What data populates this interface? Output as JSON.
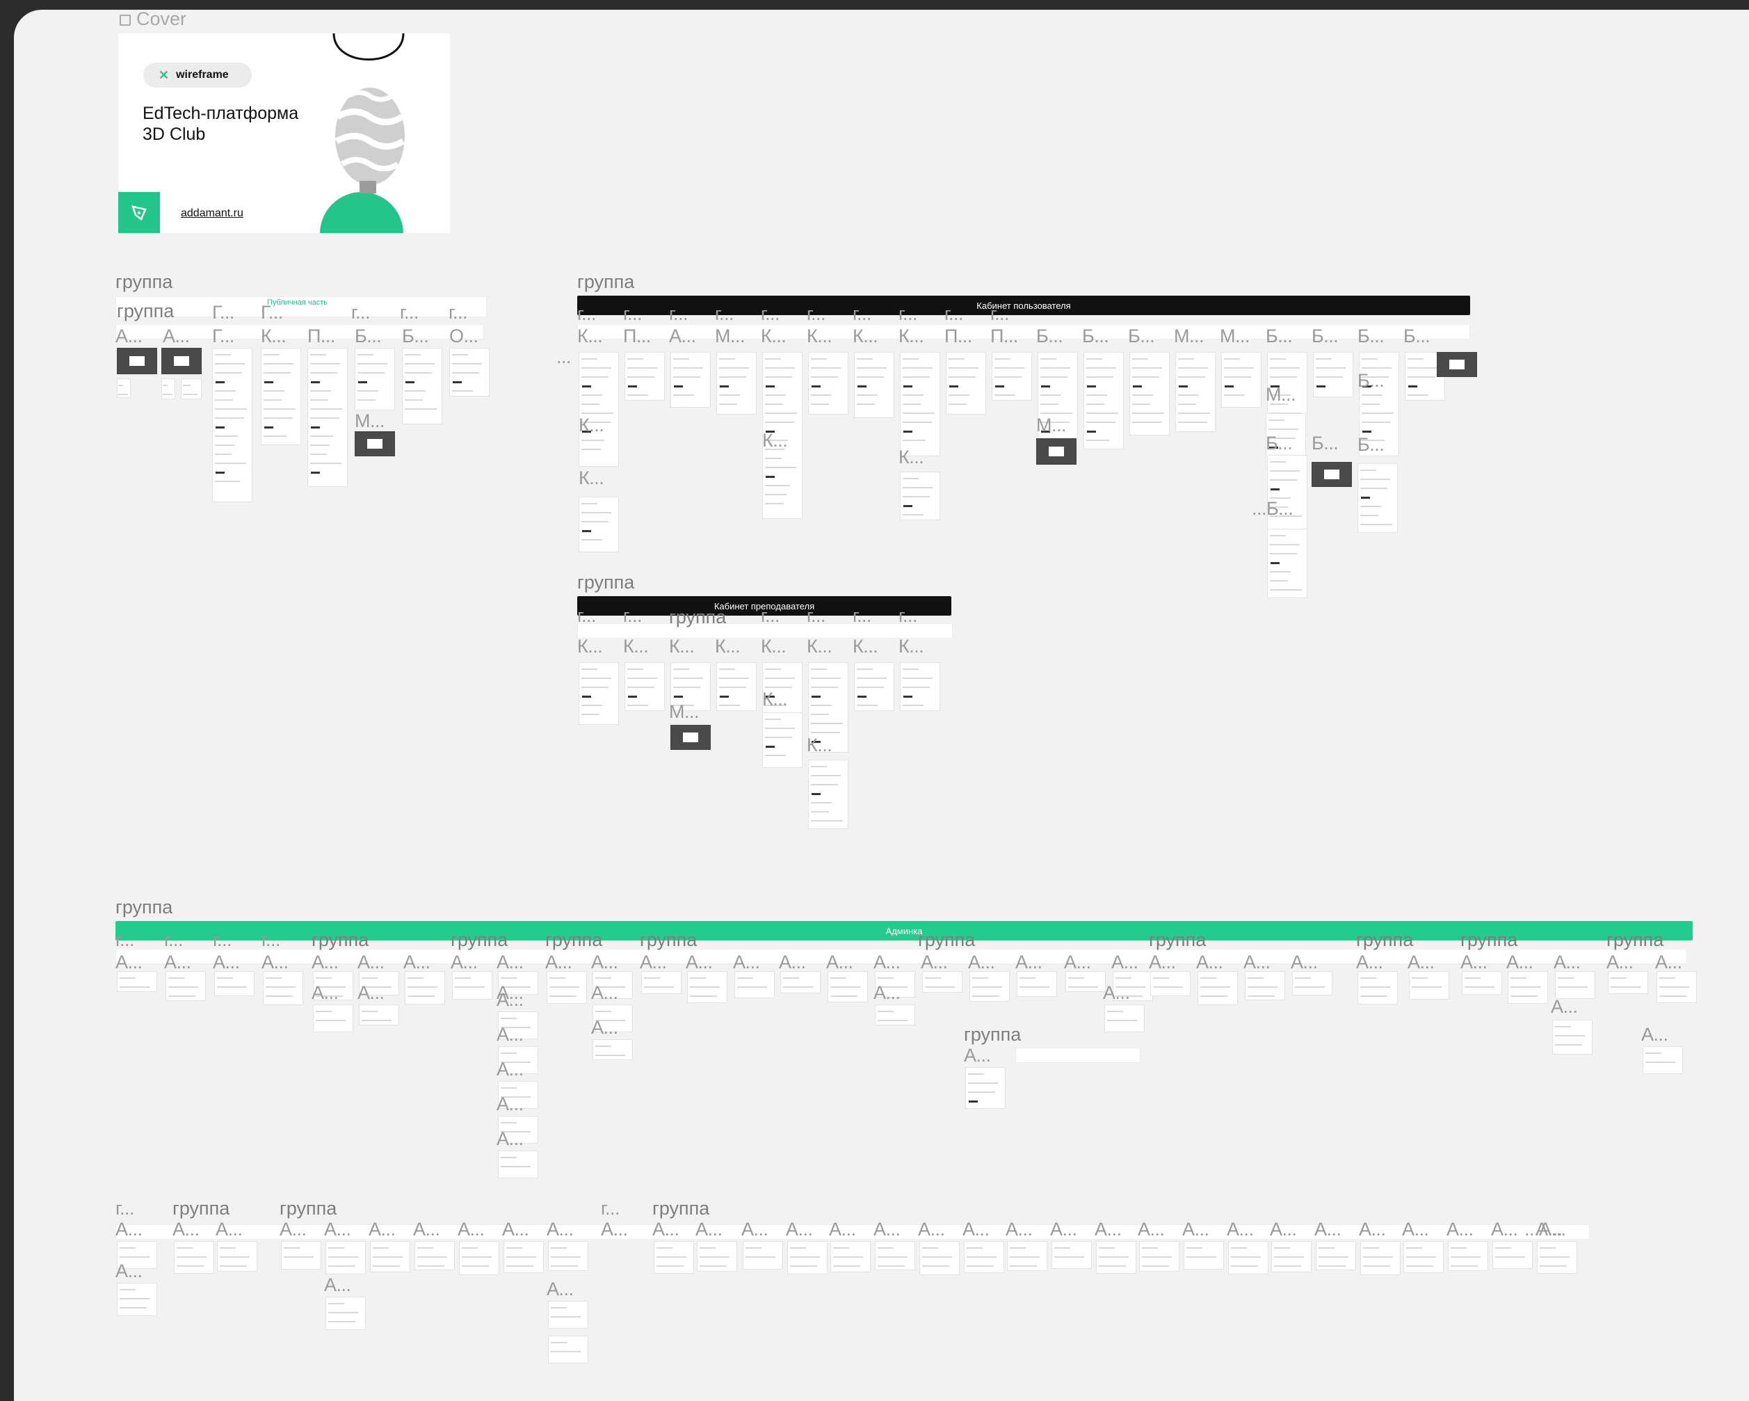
{
  "cover": {
    "section_label": "Cover",
    "badge": "wireframe",
    "title": "EdTech-платформа\n3D Club",
    "site": "addamant.ru"
  },
  "labels": {
    "group": "группа",
    "g_short": "г...",
    "G_short": "Г...",
    "A_short": "А...",
    "K_short": "К...",
    "P_short": "П...",
    "B_short": "Б...",
    "O_short": "О...",
    "M_short": "М...",
    "dots": "...",
    "dots_A": "...А...",
    "dots_B": "...Б..."
  },
  "banners": {
    "public": "Публичная часть",
    "user_cabinet": "Кабинет пользователя",
    "teacher_cabinet": "Кабинет преподавателя",
    "admin": "Админка"
  },
  "colors": {
    "canvas": "#f2f2f2",
    "background": "#2c2c2c",
    "accent_green": "#22c68b",
    "banner_black": "#111111",
    "admin_green": "#22cc8e"
  }
}
